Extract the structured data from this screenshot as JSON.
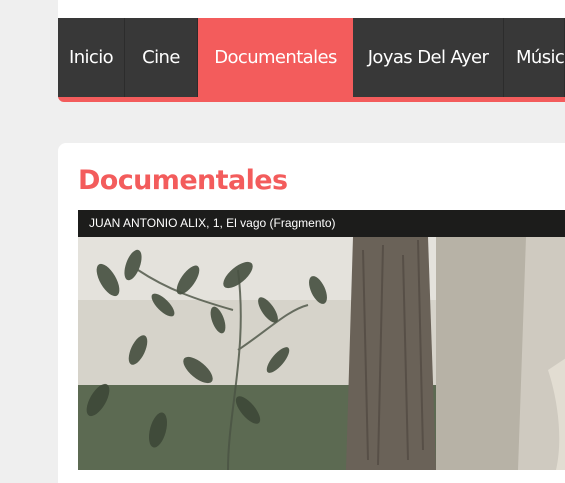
{
  "nav": {
    "items": [
      {
        "label": "Inicio",
        "active": false
      },
      {
        "label": "Cine",
        "active": false
      },
      {
        "label": "Documentales",
        "active": true
      },
      {
        "label": "Joyas Del Ayer",
        "active": false
      },
      {
        "label": "Músic",
        "active": false
      }
    ]
  },
  "page": {
    "title": "Documentales"
  },
  "video": {
    "title": "JUAN ANTONIO ALIX, 1, El vago (Fragmento)"
  },
  "colors": {
    "accent": "#f35c5c",
    "nav_background": "#383838",
    "page_background": "#efefef"
  }
}
